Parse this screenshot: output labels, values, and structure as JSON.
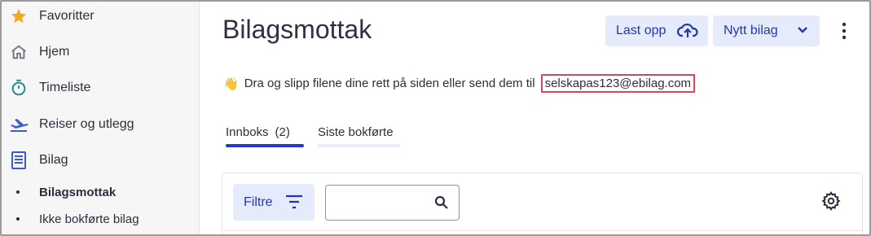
{
  "sidebar": {
    "items": [
      {
        "label": "Favoritter",
        "icon": "star-icon"
      },
      {
        "label": "Hjem",
        "icon": "home-icon"
      },
      {
        "label": "Timeliste",
        "icon": "stopwatch-icon"
      },
      {
        "label": "Reiser og utlegg",
        "icon": "airplane-icon"
      },
      {
        "label": "Bilag",
        "icon": "receipt-icon"
      }
    ],
    "subitems": [
      {
        "label": "Bilagsmottak",
        "active": true
      },
      {
        "label": "Ikke bokførte bilag",
        "active": false
      }
    ]
  },
  "header": {
    "title": "Bilagsmottak",
    "upload_label": "Last opp",
    "new_label": "Nytt bilag"
  },
  "drop_hint": {
    "emoji": "👋",
    "text": "Dra og slipp filene dine rett på siden eller send dem til",
    "email": "selskapas123@ebilag.com"
  },
  "tabs": [
    {
      "label": "Innboks",
      "count": "(2)",
      "active": true
    },
    {
      "label": "Siste bokførte",
      "active": false
    }
  ],
  "toolbar": {
    "filter_label": "Filtre",
    "search_value": ""
  },
  "colors": {
    "accent": "#1f3ad6",
    "button_bg": "#e6ebfc",
    "button_text": "#1f3aa8",
    "highlight_border": "#d9455b",
    "star": "#f5a623",
    "teal": "#2a8c8c",
    "sidebar_icon_blue": "#3e5cc9"
  }
}
